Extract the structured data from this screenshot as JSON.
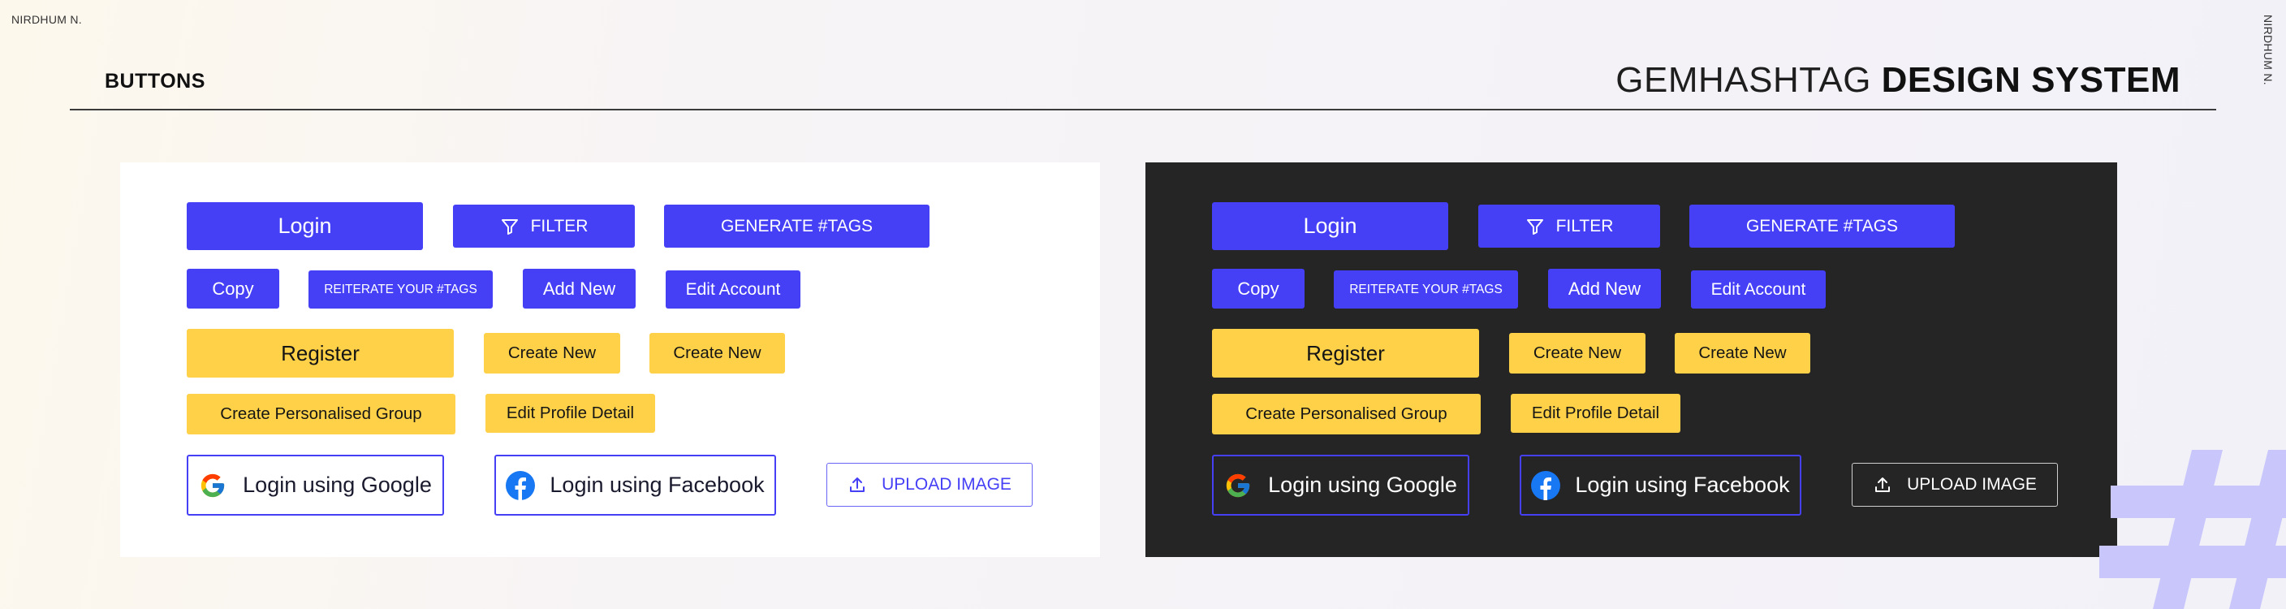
{
  "credit": "NIRDHUM N.",
  "header": {
    "section_title": "BUTTONS",
    "brand_normal": "GEMHASHTAG ",
    "brand_bold": "DESIGN SYSTEM"
  },
  "buttons": {
    "login": "Login",
    "filter": "FILTER",
    "generate_tags": "GENERATE #TAGS",
    "copy": "Copy",
    "reiterate": "REITERATE YOUR #TAGS",
    "add_new": "Add New",
    "edit_account": "Edit Account",
    "register": "Register",
    "create_new": "Create New",
    "create_group": "Create Personalised Group",
    "edit_profile": "Edit Profile Detail",
    "login_google": "Login using Google",
    "login_facebook": "Login using Facebook",
    "upload_image": "UPLOAD IMAGE"
  },
  "icons": {
    "filter": "filter-icon",
    "google": "google-icon",
    "facebook": "facebook-icon",
    "upload": "upload-icon"
  },
  "colors": {
    "primary_blue": "#4540f5",
    "accent_yellow": "#ffd148",
    "dark_panel": "#252525",
    "light_panel": "#ffffff",
    "facebook_blue": "#1877f2"
  }
}
